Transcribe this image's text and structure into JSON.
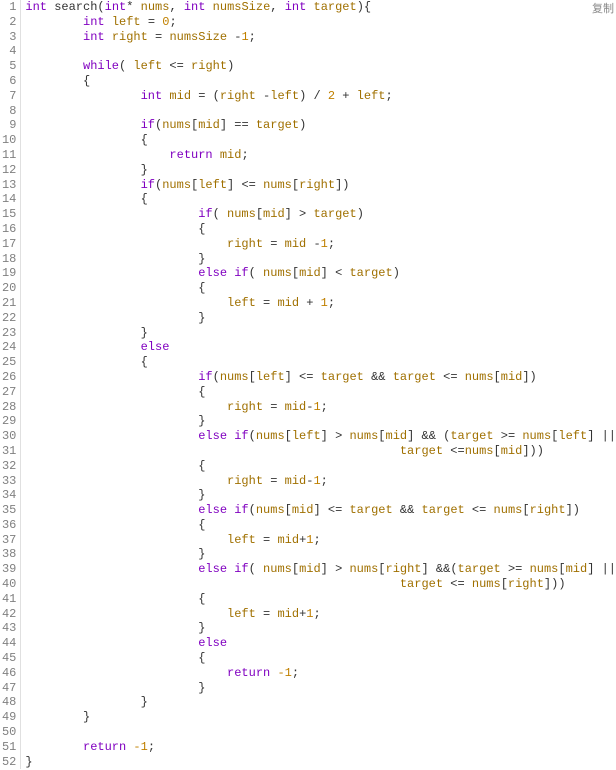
{
  "copy_label": "复制",
  "lines": [
    {
      "n": 1,
      "indent": 0,
      "tokens": [
        {
          "t": "int ",
          "c": "kw"
        },
        {
          "t": "search(",
          "c": ""
        },
        {
          "t": "int",
          "c": "kw"
        },
        {
          "t": "* ",
          "c": ""
        },
        {
          "t": "nums",
          "c": "ident"
        },
        {
          "t": ", ",
          "c": ""
        },
        {
          "t": "int ",
          "c": "kw"
        },
        {
          "t": "numsSize",
          "c": "ident"
        },
        {
          "t": ", ",
          "c": ""
        },
        {
          "t": "int ",
          "c": "kw"
        },
        {
          "t": "target",
          "c": "ident"
        },
        {
          "t": "){",
          "c": ""
        }
      ]
    },
    {
      "n": 2,
      "indent": 8,
      "tokens": [
        {
          "t": "int ",
          "c": "kw"
        },
        {
          "t": "left",
          "c": "ident"
        },
        {
          "t": " = ",
          "c": ""
        },
        {
          "t": "0",
          "c": "num"
        },
        {
          "t": ";",
          "c": ""
        }
      ]
    },
    {
      "n": 3,
      "indent": 8,
      "tokens": [
        {
          "t": "int ",
          "c": "kw"
        },
        {
          "t": "right",
          "c": "ident"
        },
        {
          "t": " = ",
          "c": ""
        },
        {
          "t": "numsSize",
          "c": "ident"
        },
        {
          "t": " -",
          "c": ""
        },
        {
          "t": "1",
          "c": "num"
        },
        {
          "t": ";",
          "c": ""
        }
      ]
    },
    {
      "n": 4,
      "indent": 0,
      "tokens": []
    },
    {
      "n": 5,
      "indent": 8,
      "tokens": [
        {
          "t": "while",
          "c": "kw"
        },
        {
          "t": "( ",
          "c": ""
        },
        {
          "t": "left",
          "c": "ident"
        },
        {
          "t": " <= ",
          "c": ""
        },
        {
          "t": "right",
          "c": "ident"
        },
        {
          "t": ")",
          "c": ""
        }
      ]
    },
    {
      "n": 6,
      "indent": 8,
      "tokens": [
        {
          "t": "{",
          "c": ""
        }
      ]
    },
    {
      "n": 7,
      "indent": 16,
      "tokens": [
        {
          "t": "int ",
          "c": "kw"
        },
        {
          "t": "mid",
          "c": "ident"
        },
        {
          "t": " = (",
          "c": ""
        },
        {
          "t": "right",
          "c": "ident"
        },
        {
          "t": " -",
          "c": ""
        },
        {
          "t": "left",
          "c": "ident"
        },
        {
          "t": ") / ",
          "c": ""
        },
        {
          "t": "2",
          "c": "num"
        },
        {
          "t": " + ",
          "c": ""
        },
        {
          "t": "left",
          "c": "ident"
        },
        {
          "t": ";",
          "c": ""
        }
      ]
    },
    {
      "n": 8,
      "indent": 0,
      "tokens": []
    },
    {
      "n": 9,
      "indent": 16,
      "tokens": [
        {
          "t": "if",
          "c": "kw"
        },
        {
          "t": "(",
          "c": ""
        },
        {
          "t": "nums",
          "c": "ident"
        },
        {
          "t": "[",
          "c": ""
        },
        {
          "t": "mid",
          "c": "ident"
        },
        {
          "t": "] == ",
          "c": ""
        },
        {
          "t": "target",
          "c": "ident"
        },
        {
          "t": ")",
          "c": ""
        }
      ]
    },
    {
      "n": 10,
      "indent": 16,
      "tokens": [
        {
          "t": "{",
          "c": ""
        }
      ]
    },
    {
      "n": 11,
      "indent": 20,
      "tokens": [
        {
          "t": "return ",
          "c": "kw"
        },
        {
          "t": "mid",
          "c": "ident"
        },
        {
          "t": ";",
          "c": ""
        }
      ]
    },
    {
      "n": 12,
      "indent": 16,
      "tokens": [
        {
          "t": "}",
          "c": ""
        }
      ]
    },
    {
      "n": 13,
      "indent": 16,
      "tokens": [
        {
          "t": "if",
          "c": "kw"
        },
        {
          "t": "(",
          "c": ""
        },
        {
          "t": "nums",
          "c": "ident"
        },
        {
          "t": "[",
          "c": ""
        },
        {
          "t": "left",
          "c": "ident"
        },
        {
          "t": "] <= ",
          "c": ""
        },
        {
          "t": "nums",
          "c": "ident"
        },
        {
          "t": "[",
          "c": ""
        },
        {
          "t": "right",
          "c": "ident"
        },
        {
          "t": "])",
          "c": ""
        }
      ]
    },
    {
      "n": 14,
      "indent": 16,
      "tokens": [
        {
          "t": "{",
          "c": ""
        }
      ]
    },
    {
      "n": 15,
      "indent": 24,
      "tokens": [
        {
          "t": "if",
          "c": "kw"
        },
        {
          "t": "( ",
          "c": ""
        },
        {
          "t": "nums",
          "c": "ident"
        },
        {
          "t": "[",
          "c": ""
        },
        {
          "t": "mid",
          "c": "ident"
        },
        {
          "t": "] > ",
          "c": ""
        },
        {
          "t": "target",
          "c": "ident"
        },
        {
          "t": ")",
          "c": ""
        }
      ]
    },
    {
      "n": 16,
      "indent": 24,
      "tokens": [
        {
          "t": "{",
          "c": ""
        }
      ]
    },
    {
      "n": 17,
      "indent": 28,
      "tokens": [
        {
          "t": "right",
          "c": "ident"
        },
        {
          "t": " = ",
          "c": ""
        },
        {
          "t": "mid",
          "c": "ident"
        },
        {
          "t": " -",
          "c": ""
        },
        {
          "t": "1",
          "c": "num"
        },
        {
          "t": ";",
          "c": ""
        }
      ]
    },
    {
      "n": 18,
      "indent": 24,
      "tokens": [
        {
          "t": "}",
          "c": ""
        }
      ]
    },
    {
      "n": 19,
      "indent": 24,
      "tokens": [
        {
          "t": "else if",
          "c": "kw"
        },
        {
          "t": "( ",
          "c": ""
        },
        {
          "t": "nums",
          "c": "ident"
        },
        {
          "t": "[",
          "c": ""
        },
        {
          "t": "mid",
          "c": "ident"
        },
        {
          "t": "] < ",
          "c": ""
        },
        {
          "t": "target",
          "c": "ident"
        },
        {
          "t": ")",
          "c": ""
        }
      ]
    },
    {
      "n": 20,
      "indent": 24,
      "tokens": [
        {
          "t": "{",
          "c": ""
        }
      ]
    },
    {
      "n": 21,
      "indent": 28,
      "tokens": [
        {
          "t": "left",
          "c": "ident"
        },
        {
          "t": " = ",
          "c": ""
        },
        {
          "t": "mid",
          "c": "ident"
        },
        {
          "t": " + ",
          "c": ""
        },
        {
          "t": "1",
          "c": "num"
        },
        {
          "t": ";",
          "c": ""
        }
      ]
    },
    {
      "n": 22,
      "indent": 24,
      "tokens": [
        {
          "t": "}",
          "c": ""
        }
      ]
    },
    {
      "n": 23,
      "indent": 16,
      "tokens": [
        {
          "t": "}",
          "c": ""
        }
      ]
    },
    {
      "n": 24,
      "indent": 16,
      "tokens": [
        {
          "t": "else",
          "c": "kw"
        }
      ]
    },
    {
      "n": 25,
      "indent": 16,
      "tokens": [
        {
          "t": "{",
          "c": ""
        }
      ]
    },
    {
      "n": 26,
      "indent": 24,
      "tokens": [
        {
          "t": "if",
          "c": "kw"
        },
        {
          "t": "(",
          "c": ""
        },
        {
          "t": "nums",
          "c": "ident"
        },
        {
          "t": "[",
          "c": ""
        },
        {
          "t": "left",
          "c": "ident"
        },
        {
          "t": "] <= ",
          "c": ""
        },
        {
          "t": "target",
          "c": "ident"
        },
        {
          "t": " && ",
          "c": ""
        },
        {
          "t": "target",
          "c": "ident"
        },
        {
          "t": " <= ",
          "c": ""
        },
        {
          "t": "nums",
          "c": "ident"
        },
        {
          "t": "[",
          "c": ""
        },
        {
          "t": "mid",
          "c": "ident"
        },
        {
          "t": "])",
          "c": ""
        }
      ]
    },
    {
      "n": 27,
      "indent": 24,
      "tokens": [
        {
          "t": "{",
          "c": ""
        }
      ]
    },
    {
      "n": 28,
      "indent": 28,
      "tokens": [
        {
          "t": "right",
          "c": "ident"
        },
        {
          "t": " = ",
          "c": ""
        },
        {
          "t": "mid",
          "c": "ident"
        },
        {
          "t": "-",
          "c": ""
        },
        {
          "t": "1",
          "c": "num"
        },
        {
          "t": ";",
          "c": ""
        }
      ]
    },
    {
      "n": 29,
      "indent": 24,
      "tokens": [
        {
          "t": "}",
          "c": ""
        }
      ]
    },
    {
      "n": 30,
      "indent": 24,
      "tokens": [
        {
          "t": "else if",
          "c": "kw"
        },
        {
          "t": "(",
          "c": ""
        },
        {
          "t": "nums",
          "c": "ident"
        },
        {
          "t": "[",
          "c": ""
        },
        {
          "t": "left",
          "c": "ident"
        },
        {
          "t": "] > ",
          "c": ""
        },
        {
          "t": "nums",
          "c": "ident"
        },
        {
          "t": "[",
          "c": ""
        },
        {
          "t": "mid",
          "c": "ident"
        },
        {
          "t": "] && (",
          "c": ""
        },
        {
          "t": "target",
          "c": "ident"
        },
        {
          "t": " >= ",
          "c": ""
        },
        {
          "t": "nums",
          "c": "ident"
        },
        {
          "t": "[",
          "c": ""
        },
        {
          "t": "left",
          "c": "ident"
        },
        {
          "t": "] ||",
          "c": ""
        }
      ]
    },
    {
      "n": 31,
      "indent": 52,
      "tokens": [
        {
          "t": "target",
          "c": "ident"
        },
        {
          "t": " <=",
          "c": ""
        },
        {
          "t": "nums",
          "c": "ident"
        },
        {
          "t": "[",
          "c": ""
        },
        {
          "t": "mid",
          "c": "ident"
        },
        {
          "t": "]))",
          "c": ""
        }
      ]
    },
    {
      "n": 32,
      "indent": 24,
      "tokens": [
        {
          "t": "{",
          "c": ""
        }
      ]
    },
    {
      "n": 33,
      "indent": 28,
      "tokens": [
        {
          "t": "right",
          "c": "ident"
        },
        {
          "t": " = ",
          "c": ""
        },
        {
          "t": "mid",
          "c": "ident"
        },
        {
          "t": "-",
          "c": ""
        },
        {
          "t": "1",
          "c": "num"
        },
        {
          "t": ";",
          "c": ""
        }
      ]
    },
    {
      "n": 34,
      "indent": 24,
      "tokens": [
        {
          "t": "}",
          "c": ""
        }
      ]
    },
    {
      "n": 35,
      "indent": 24,
      "tokens": [
        {
          "t": "else if",
          "c": "kw"
        },
        {
          "t": "(",
          "c": ""
        },
        {
          "t": "nums",
          "c": "ident"
        },
        {
          "t": "[",
          "c": ""
        },
        {
          "t": "mid",
          "c": "ident"
        },
        {
          "t": "] <= ",
          "c": ""
        },
        {
          "t": "target",
          "c": "ident"
        },
        {
          "t": " && ",
          "c": ""
        },
        {
          "t": "target",
          "c": "ident"
        },
        {
          "t": " <= ",
          "c": ""
        },
        {
          "t": "nums",
          "c": "ident"
        },
        {
          "t": "[",
          "c": ""
        },
        {
          "t": "right",
          "c": "ident"
        },
        {
          "t": "])",
          "c": ""
        }
      ]
    },
    {
      "n": 36,
      "indent": 24,
      "tokens": [
        {
          "t": "{",
          "c": ""
        }
      ]
    },
    {
      "n": 37,
      "indent": 28,
      "tokens": [
        {
          "t": "left",
          "c": "ident"
        },
        {
          "t": " = ",
          "c": ""
        },
        {
          "t": "mid",
          "c": "ident"
        },
        {
          "t": "+",
          "c": ""
        },
        {
          "t": "1",
          "c": "num"
        },
        {
          "t": ";",
          "c": ""
        }
      ]
    },
    {
      "n": 38,
      "indent": 24,
      "tokens": [
        {
          "t": "}",
          "c": ""
        }
      ]
    },
    {
      "n": 39,
      "indent": 24,
      "tokens": [
        {
          "t": "else if",
          "c": "kw"
        },
        {
          "t": "( ",
          "c": ""
        },
        {
          "t": "nums",
          "c": "ident"
        },
        {
          "t": "[",
          "c": ""
        },
        {
          "t": "mid",
          "c": "ident"
        },
        {
          "t": "] > ",
          "c": ""
        },
        {
          "t": "nums",
          "c": "ident"
        },
        {
          "t": "[",
          "c": ""
        },
        {
          "t": "right",
          "c": "ident"
        },
        {
          "t": "] &&(",
          "c": ""
        },
        {
          "t": "target",
          "c": "ident"
        },
        {
          "t": " >= ",
          "c": ""
        },
        {
          "t": "nums",
          "c": "ident"
        },
        {
          "t": "[",
          "c": ""
        },
        {
          "t": "mid",
          "c": "ident"
        },
        {
          "t": "] ||",
          "c": ""
        }
      ]
    },
    {
      "n": 40,
      "indent": 52,
      "tokens": [
        {
          "t": "target",
          "c": "ident"
        },
        {
          "t": " <= ",
          "c": ""
        },
        {
          "t": "nums",
          "c": "ident"
        },
        {
          "t": "[",
          "c": ""
        },
        {
          "t": "right",
          "c": "ident"
        },
        {
          "t": "]))",
          "c": ""
        }
      ]
    },
    {
      "n": 41,
      "indent": 24,
      "tokens": [
        {
          "t": "{",
          "c": ""
        }
      ]
    },
    {
      "n": 42,
      "indent": 28,
      "tokens": [
        {
          "t": "left",
          "c": "ident"
        },
        {
          "t": " = ",
          "c": ""
        },
        {
          "t": "mid",
          "c": "ident"
        },
        {
          "t": "+",
          "c": ""
        },
        {
          "t": "1",
          "c": "num"
        },
        {
          "t": ";",
          "c": ""
        }
      ]
    },
    {
      "n": 43,
      "indent": 24,
      "tokens": [
        {
          "t": "}",
          "c": ""
        }
      ]
    },
    {
      "n": 44,
      "indent": 24,
      "tokens": [
        {
          "t": "else",
          "c": "kw"
        }
      ]
    },
    {
      "n": 45,
      "indent": 24,
      "tokens": [
        {
          "t": "{",
          "c": ""
        }
      ]
    },
    {
      "n": 46,
      "indent": 28,
      "tokens": [
        {
          "t": "return ",
          "c": "kw"
        },
        {
          "t": "-1",
          "c": "num"
        },
        {
          "t": ";",
          "c": ""
        }
      ]
    },
    {
      "n": 47,
      "indent": 24,
      "tokens": [
        {
          "t": "}",
          "c": ""
        }
      ]
    },
    {
      "n": 48,
      "indent": 16,
      "tokens": [
        {
          "t": "}",
          "c": ""
        }
      ]
    },
    {
      "n": 49,
      "indent": 8,
      "tokens": [
        {
          "t": "}",
          "c": ""
        }
      ]
    },
    {
      "n": 50,
      "indent": 0,
      "tokens": []
    },
    {
      "n": 51,
      "indent": 8,
      "tokens": [
        {
          "t": "return ",
          "c": "kw"
        },
        {
          "t": "-1",
          "c": "num"
        },
        {
          "t": ";",
          "c": ""
        }
      ]
    },
    {
      "n": 52,
      "indent": 0,
      "tokens": [
        {
          "t": "}",
          "c": ""
        }
      ]
    }
  ]
}
